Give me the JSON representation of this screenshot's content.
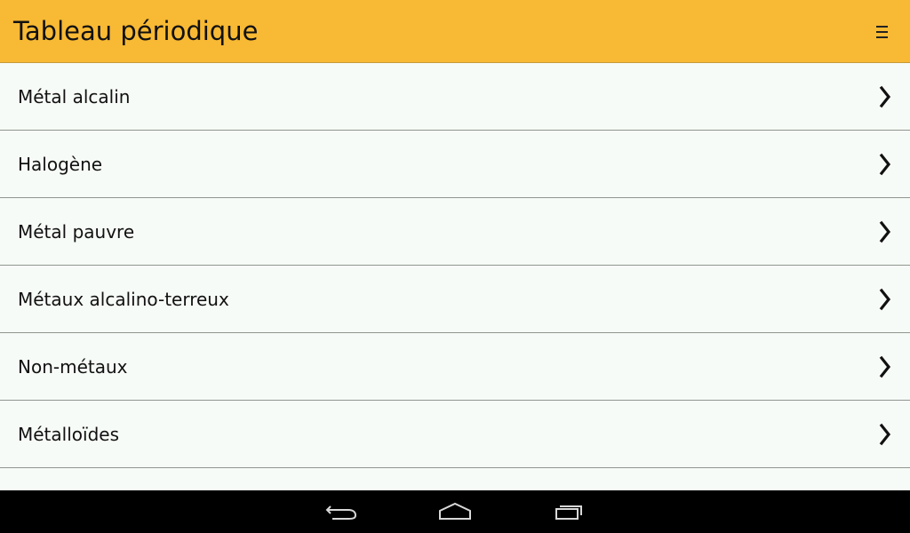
{
  "app": {
    "title": "Tableau périodique",
    "menu_icon": "menu-icon",
    "header_color": "#f8b934"
  },
  "list": {
    "items": [
      {
        "label": "Métal alcalin",
        "icon": "chevron-right-icon"
      },
      {
        "label": "Halogène",
        "icon": "chevron-right-icon"
      },
      {
        "label": "Métal pauvre",
        "icon": "chevron-right-icon"
      },
      {
        "label": "Métaux alcalino-terreux",
        "icon": "chevron-right-icon"
      },
      {
        "label": "Non-métaux",
        "icon": "chevron-right-icon"
      },
      {
        "label": "Métalloïdes",
        "icon": "chevron-right-icon"
      },
      {
        "label": "",
        "icon": "chevron-right-icon"
      }
    ]
  },
  "nav_bar": {
    "buttons": [
      "back-icon",
      "home-icon",
      "recent-apps-icon"
    ]
  }
}
